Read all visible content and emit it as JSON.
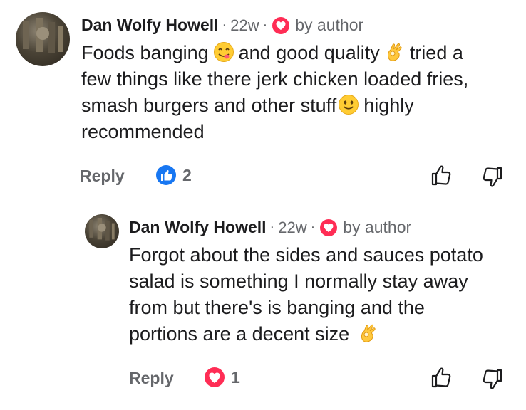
{
  "comments": [
    {
      "author": "Dan Wolfy Howell",
      "sep1": "·",
      "time": "22w",
      "sep2": "·",
      "badge_icon": "heart-icon",
      "badge_label": "by author",
      "text_parts": [
        "Foods banging",
        "and good quality",
        "tried a",
        "few things like there jerk chicken loaded fries,",
        "smash burgers and other stuff",
        "highly",
        "recommended"
      ],
      "emojis": [
        "yum-face-emoji",
        "ok-hand-emoji",
        "smiling-face-emoji"
      ],
      "reply_label": "Reply",
      "reaction_icon": "like-icon",
      "reaction_count": "2"
    },
    {
      "author": "Dan Wolfy Howell",
      "sep1": "·",
      "time": "22w",
      "sep2": "·",
      "badge_icon": "heart-icon",
      "badge_label": "by author",
      "text_lines": [
        "Forgot about the sides and sauces potato",
        "salad is something I normally stay away",
        "from but there's is banging and the",
        "portions are a decent size"
      ],
      "emojis": [
        "ok-hand-emoji"
      ],
      "reply_label": "Reply",
      "reaction_icon": "love-icon",
      "reaction_count": "1"
    }
  ],
  "colors": {
    "text": "#1c1c1e",
    "muted": "#65676b",
    "heart": "#ff2d55",
    "like": "#1877f2"
  }
}
